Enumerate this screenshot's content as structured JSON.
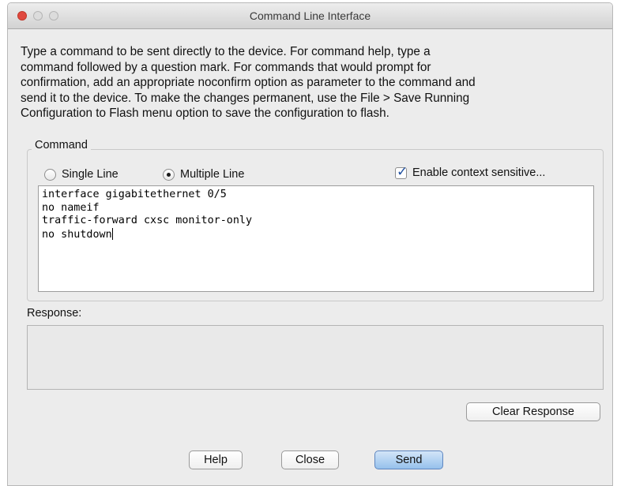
{
  "window": {
    "title": "Command Line Interface"
  },
  "instructions": {
    "lines": [
      "Type a command to be sent directly to the device. For command help, type a",
      "command followed by a question mark. For commands that would prompt for",
      "confirmation, add an appropriate noconfirm option as parameter to the command and",
      "send it to the device. To make the changes permanent, use the File > Save Running",
      "Configuration to Flash menu option to save the configuration to flash."
    ]
  },
  "command": {
    "group_label": "Command",
    "mode_options": [
      {
        "label": "Single Line",
        "selected": false
      },
      {
        "label": "Multiple Line",
        "selected": true
      }
    ],
    "context_sensitive": {
      "label": "Enable context sensitive...",
      "checked": true
    },
    "lines": [
      "interface gigabitethernet 0/5",
      "no nameif",
      "traffic-forward cxsc monitor-only",
      "no shutdown"
    ]
  },
  "response": {
    "label": "Response:",
    "value": ""
  },
  "buttons": {
    "clear_response": "Clear Response",
    "help": "Help",
    "close": "Close",
    "send": "Send"
  },
  "colors": {
    "close_light": "#e0483e",
    "default_button": "#96c1ec",
    "check_mark": "#1f4f9f"
  }
}
